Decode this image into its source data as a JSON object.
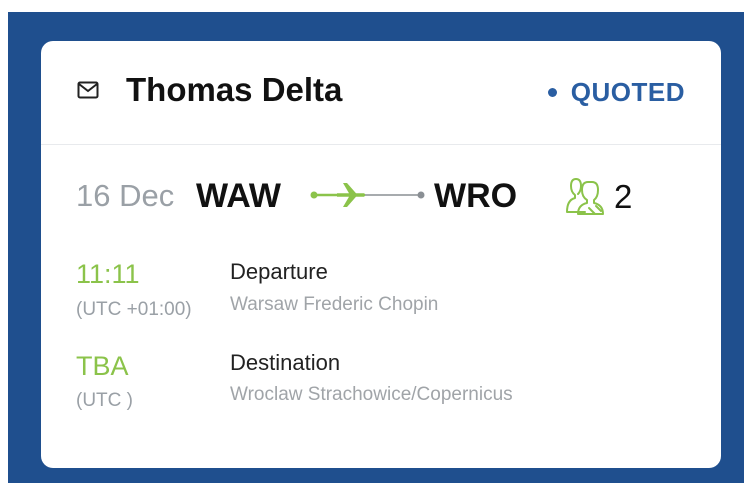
{
  "header": {
    "icon": "mail-icon",
    "title": "Thomas Delta",
    "status": "QUOTED",
    "status_color": "#2a5ea2"
  },
  "route": {
    "date": "16 Dec",
    "from": "WAW",
    "to": "WRO",
    "arrow_icon": "plane-route-icon",
    "passenger_icon": "passengers-icon",
    "passengers": "2",
    "accent_color": "#8bc34a"
  },
  "departure": {
    "time": "11:11",
    "timezone": "(UTC +01:00)",
    "label": "Departure",
    "airport": "Warsaw Frederic Chopin"
  },
  "destination": {
    "time": "TBA",
    "timezone": "(UTC )",
    "label": "Destination",
    "airport": "Wroclaw Strachowice/Copernicus"
  }
}
